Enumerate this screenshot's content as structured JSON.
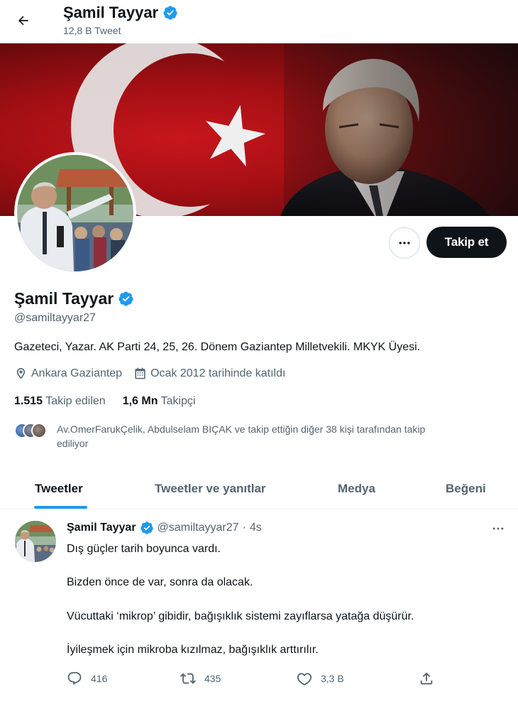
{
  "header": {
    "name": "Şamil Tayyar",
    "tweet_count": "12,8 B Tweet",
    "back_icon": "arrow-left-icon",
    "verified_icon": "verified-badge-icon"
  },
  "profile": {
    "name": "Şamil Tayyar",
    "handle": "@samiltayyar27",
    "bio": "Gazeteci, Yazar. AK Parti 24, 25, 26. Dönem Gaziantep Milletvekili. MKYK Üyesi.",
    "location": "Ankara Gaziantep",
    "joined": "Ocak 2012 tarihinde katıldı",
    "following_count": "1.515",
    "following_label": "Takip edilen",
    "followers_count": "1,6 Mn",
    "followers_label": "Takipçi",
    "mutual_text_line1": "Av.OmerFarukÇelik, Abdulselam BIÇAK ve takip ettiğin diğer 38 kişi tarafından takip",
    "mutual_text_line2": "ediliyor"
  },
  "buttons": {
    "follow": "Takip et",
    "more_icon": "more-horizontal-icon"
  },
  "tabs": [
    {
      "label": "Tweetler",
      "active": true
    },
    {
      "label": "Tweetler ve yanıtlar",
      "active": false
    },
    {
      "label": "Medya",
      "active": false
    },
    {
      "label": "Beğeni",
      "active": false
    }
  ],
  "tweet": {
    "author": "Şamil Tayyar",
    "handle": "@samiltayyar27",
    "time": "4s",
    "separator": "·",
    "lines": [
      "Dış güçler tarih boyunca vardı.",
      "Bizden önce de var, sonra da olacak.",
      "Vücuttaki ‘mikrop’ gibidir, bağışıklık sistemi zayıflarsa yatağa düşürür.",
      "İyileşmek için mikroba kızılmaz, bağışıklık arttırılır."
    ],
    "replies": "416",
    "retweets": "435",
    "likes": "3,3 B"
  },
  "colors": {
    "accent": "#1d9bf0",
    "text": "#0f1419",
    "muted": "#536471",
    "banner_red": "#b3161b"
  }
}
